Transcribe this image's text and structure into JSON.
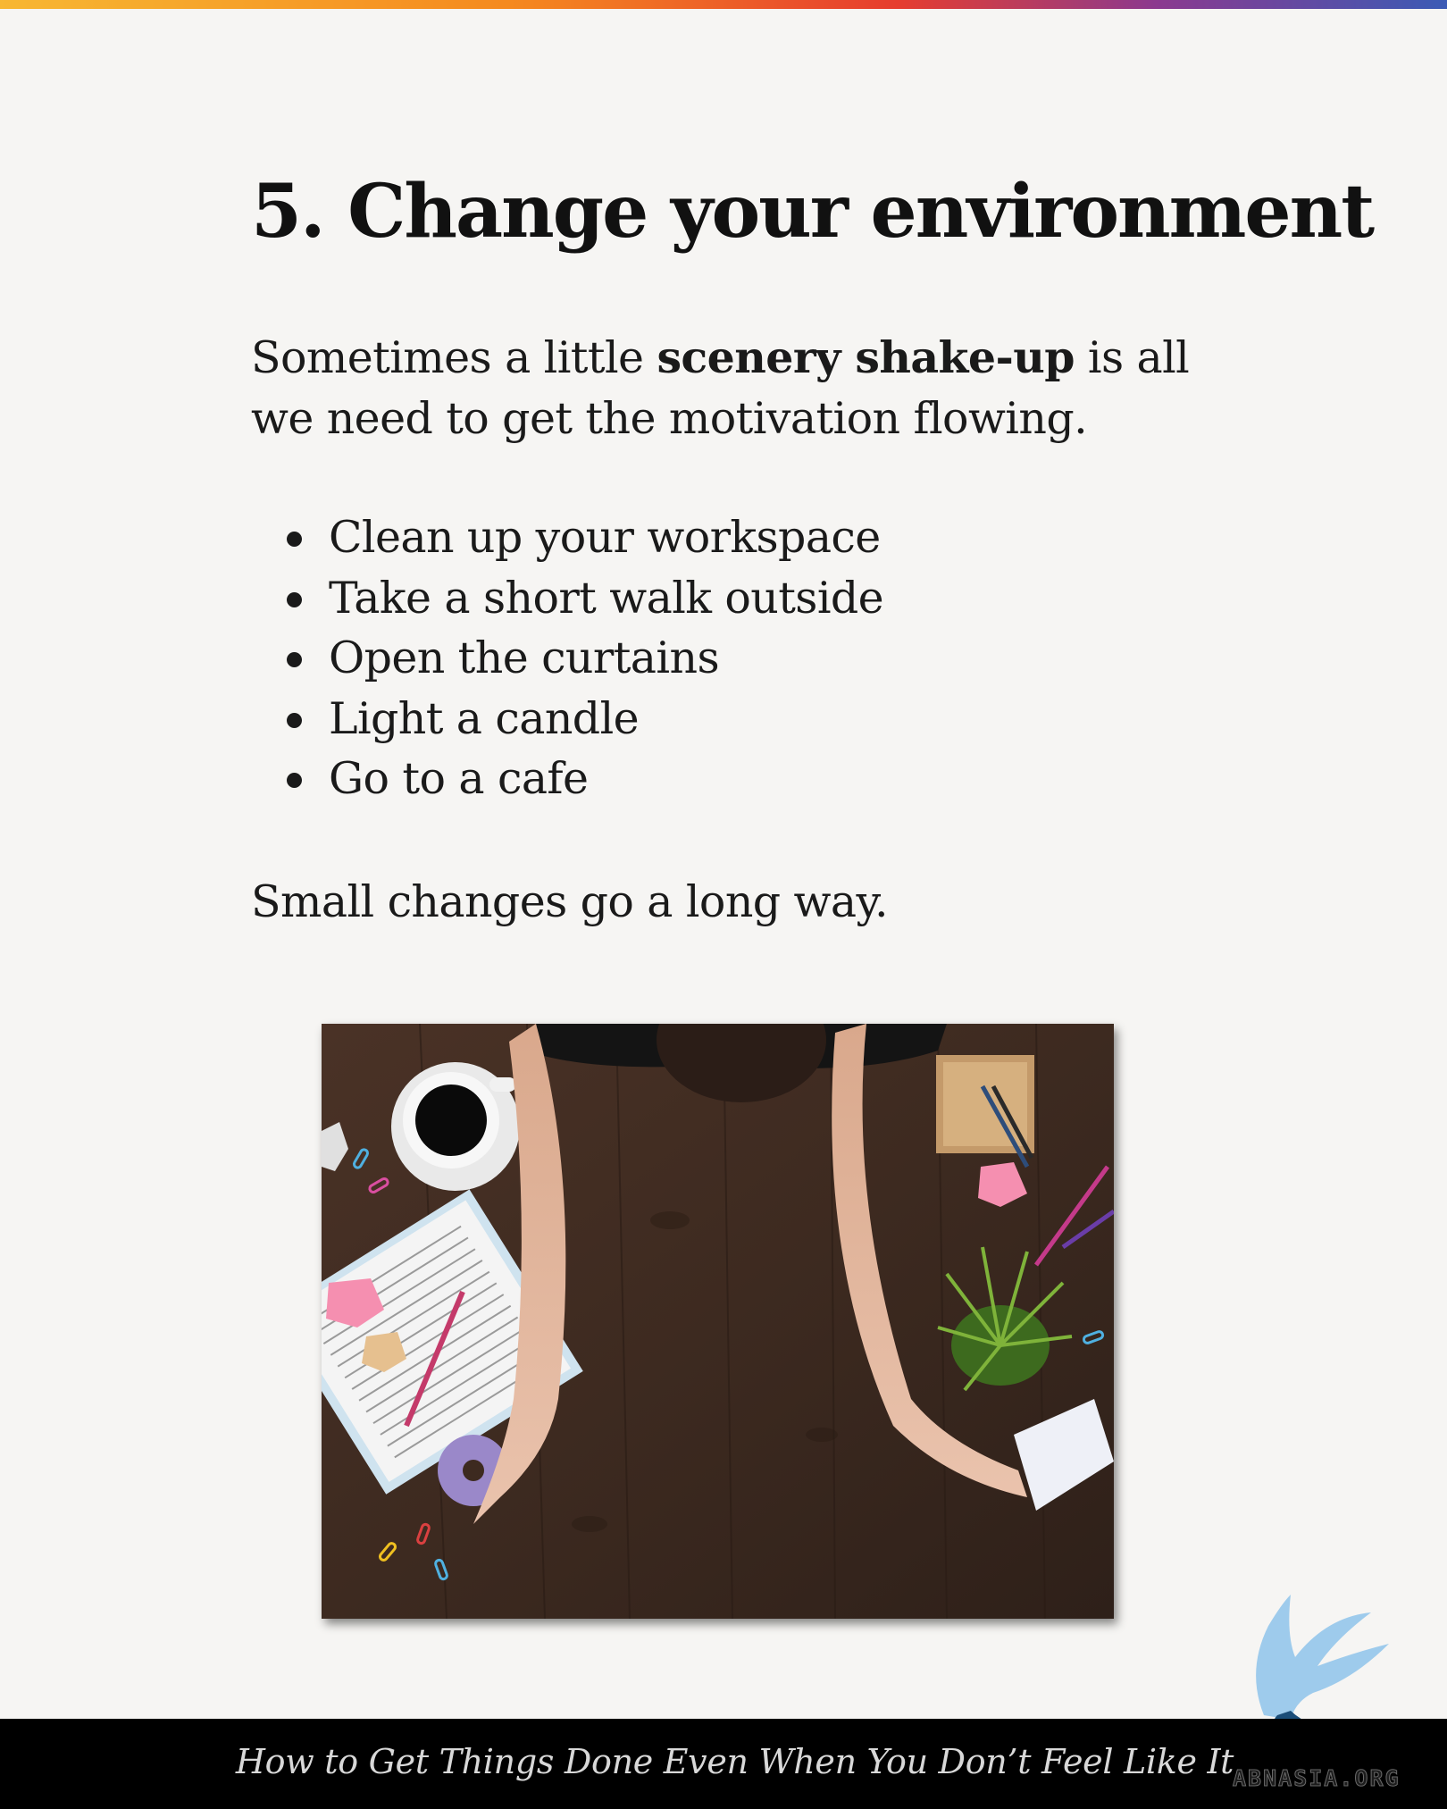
{
  "header": {
    "accent_colors": [
      "#f7b733",
      "#f58a1f",
      "#e63d2f",
      "#8b3a8f",
      "#3b5bb5"
    ]
  },
  "section": {
    "title": "5. Change your environment",
    "intro_before": "Sometimes a little ",
    "intro_bold": "scenery shake-up",
    "intro_after": " is all we need to get the motivation flowing.",
    "tips": [
      "Clean up your workspace",
      "Take a short walk outside",
      "Open the curtains",
      "Light a candle",
      "Go to a cafe"
    ],
    "closing": "Small changes go a long way."
  },
  "photo": {
    "icon": "desk-workspace-photo"
  },
  "logo": {
    "icon": "phoenix-logo-icon"
  },
  "footer": {
    "book_title": "How to Get Things Done Even When You Don’t Feel Like It",
    "watermark": "ABNASIA.ORG"
  }
}
